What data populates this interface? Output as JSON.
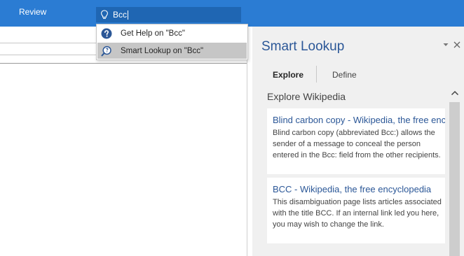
{
  "ribbon": {
    "active_tab": "Review",
    "colors": {
      "ribbon": "#2b7cd3",
      "search_box": "#1f66b3"
    }
  },
  "search": {
    "value": "Bcc",
    "icon": "lightbulb-icon"
  },
  "dropdown": {
    "items": [
      {
        "label": "Get Help on \"Bcc\"",
        "icon": "help-circle-icon"
      },
      {
        "label": "Smart Lookup on \"Bcc\"",
        "icon": "smart-lookup-icon"
      }
    ]
  },
  "panel": {
    "title": "Smart Lookup",
    "tabs": [
      {
        "label": "Explore",
        "selected": true
      },
      {
        "label": "Define",
        "selected": false
      }
    ],
    "section_heading": "Explore Wikipedia",
    "results": [
      {
        "title": "Blind carbon copy - Wikipedia, the free encyclopedia",
        "snippet": "Blind carbon copy (abbreviated Bcc:) allows the sender of a message to conceal the person entered in the Bcc: field from the other recipients."
      },
      {
        "title": "BCC - Wikipedia, the free encyclopedia",
        "snippet": "This disambiguation page lists articles associated with the title BCC. If an internal link led you here, you may wish to change the link."
      }
    ]
  }
}
